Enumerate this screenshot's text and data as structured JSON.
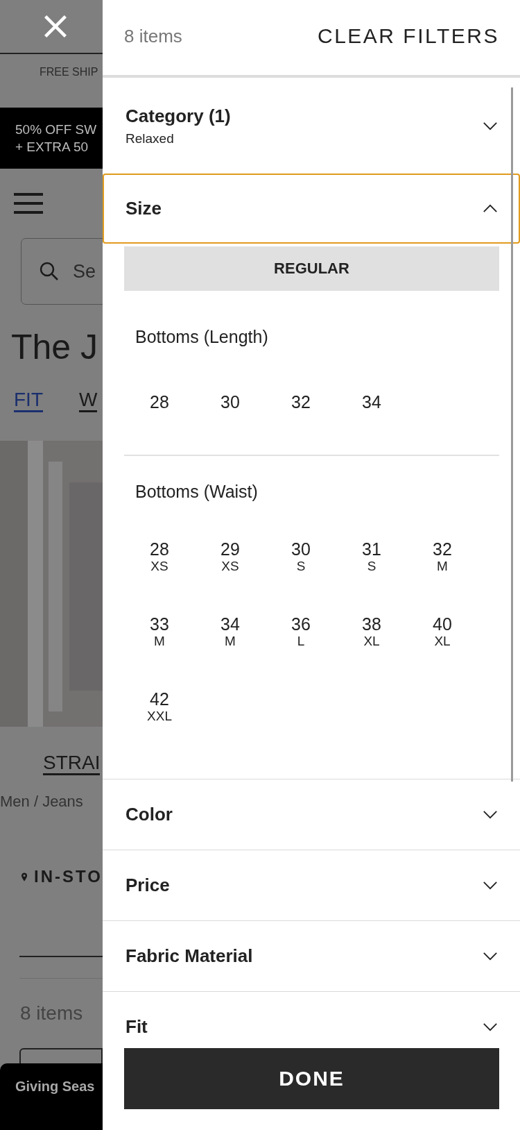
{
  "background_page": {
    "promo_bar": "FREE SHIP",
    "banner": [
      "50% OFF SW",
      "+ EXTRA 50"
    ],
    "search": {
      "placeholder": "Se"
    },
    "title": "The J",
    "tabs": [
      {
        "label": "FIT",
        "selected": true
      },
      {
        "label": "W",
        "selected": false
      }
    ],
    "category_link": "STRAI",
    "breadcrumb": "Men / Jeans",
    "store_filter": "IN-STO",
    "item_count": "8 items",
    "bottom_banner": "Giving Seas"
  },
  "drawer": {
    "item_count": "8 items",
    "clear_button": "CLEAR FILTERS",
    "filters": [
      {
        "title": "Category (1)",
        "summary": "Relaxed",
        "expanded": false,
        "focused": false
      },
      {
        "title": "Size",
        "expanded": true,
        "focused": true,
        "size_type": "REGULAR",
        "groups": [
          {
            "title": "Bottoms (Length)",
            "sizes": [
              {
                "value": "28"
              },
              {
                "value": "30"
              },
              {
                "value": "32"
              },
              {
                "value": "34"
              }
            ]
          },
          {
            "title": "Bottoms (Waist)",
            "sizes": [
              {
                "value": "28",
                "label": "XS"
              },
              {
                "value": "29",
                "label": "XS"
              },
              {
                "value": "30",
                "label": "S"
              },
              {
                "value": "31",
                "label": "S"
              },
              {
                "value": "32",
                "label": "M"
              },
              {
                "value": "33",
                "label": "M"
              },
              {
                "value": "34",
                "label": "M"
              },
              {
                "value": "36",
                "label": "L"
              },
              {
                "value": "38",
                "label": "XL"
              },
              {
                "value": "40",
                "label": "XL"
              },
              {
                "value": "42",
                "label": "XXL"
              }
            ]
          }
        ]
      },
      {
        "title": "Color",
        "expanded": false,
        "focused": false
      },
      {
        "title": "Price",
        "expanded": false,
        "focused": false
      },
      {
        "title": "Fabric Material",
        "expanded": false,
        "focused": false
      },
      {
        "title": "Fit",
        "expanded": false,
        "focused": false
      }
    ],
    "done_button": "DONE"
  }
}
